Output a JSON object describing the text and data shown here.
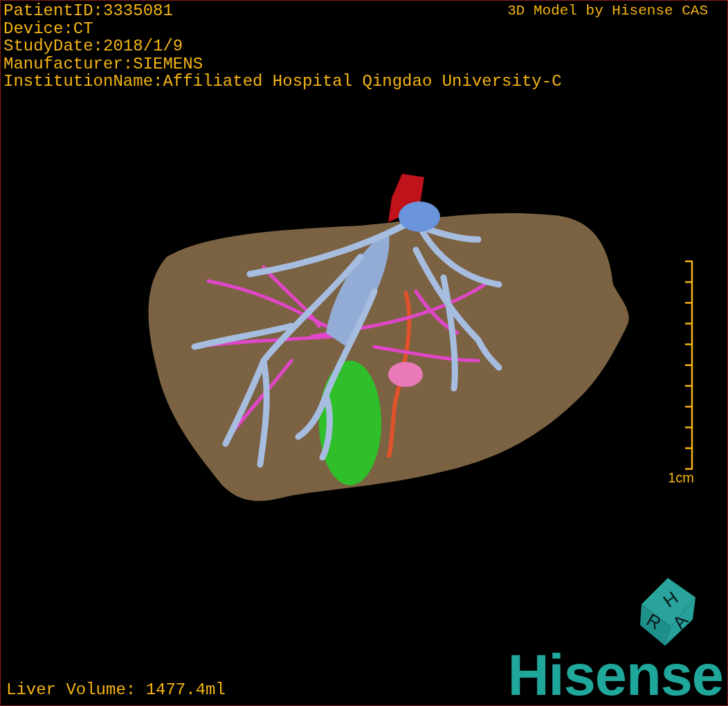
{
  "overlay": {
    "info_lines": [
      "PatientID:3335081",
      "Device:CT",
      "StudyDate:2018/1/9",
      "Manufacturer:SIEMENS",
      "InstitutionName:Affiliated Hospital Qingdao University-C"
    ],
    "title": "3D Model by Hisense CAS",
    "volume": "Liver Volume: 1477.4ml"
  },
  "scale_bar": {
    "label": "1cm"
  },
  "orientation_cube": {
    "faces": [
      "H",
      "R",
      "A"
    ]
  },
  "logo": "Hisense"
}
